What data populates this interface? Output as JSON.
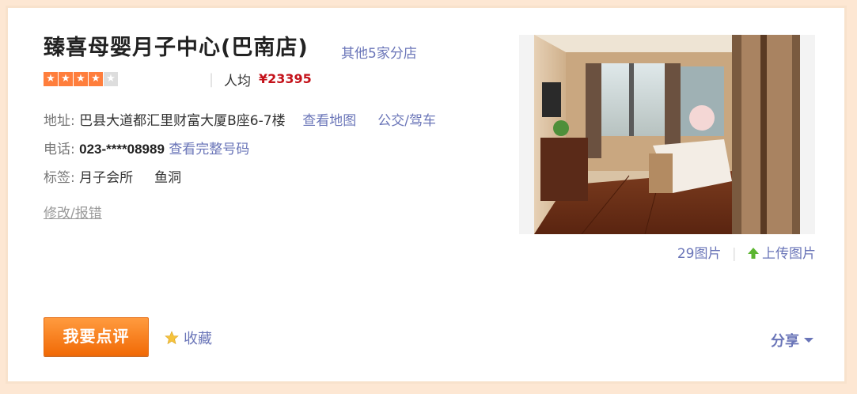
{
  "shop": {
    "name": "臻喜母婴月子中心(巴南店)",
    "branches_link": "其他5家分店",
    "rating_stars": 4,
    "rating_max": 5,
    "avg_label": "人均",
    "avg_price": "¥23395"
  },
  "address": {
    "label": "地址:",
    "value": "巴县大道都汇里财富大厦B座6-7楼",
    "map_link": "查看地图",
    "transit_link": "公交/驾车"
  },
  "phone": {
    "label": "电话:",
    "value": "023-****08989",
    "full_link": "查看完整号码"
  },
  "tags": {
    "label": "标签:",
    "items": [
      "月子会所",
      "鱼洞"
    ]
  },
  "edit_link": "修改/报错",
  "photos": {
    "count_link": "29图片",
    "upload_link": "上传图片"
  },
  "actions": {
    "review_button": "我要点评",
    "favorite": "收藏",
    "share": "分享"
  },
  "colors": {
    "accent_link": "#6a75b8",
    "price": "#c4121a",
    "button_orange": "#f17a1a",
    "star_on": "#ff7e3c",
    "border": "#f8e2cc"
  }
}
